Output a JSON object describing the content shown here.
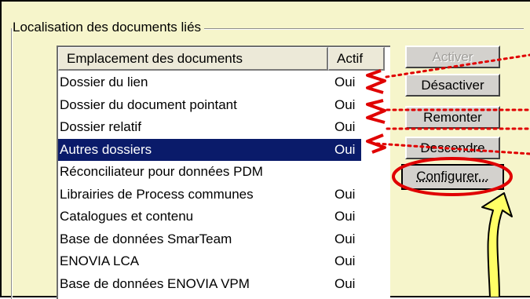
{
  "group": {
    "title": "Localisation des documents liés"
  },
  "list": {
    "columns": [
      "Emplacement des documents",
      "Actif"
    ],
    "rows": [
      {
        "location": "Dossier du lien",
        "active": "Oui",
        "selected": false
      },
      {
        "location": "Dossier du document pointant",
        "active": "Oui",
        "selected": false
      },
      {
        "location": "Dossier relatif",
        "active": "Oui",
        "selected": false
      },
      {
        "location": "Autres dossiers",
        "active": "Oui",
        "selected": true
      },
      {
        "location": "Réconciliateur pour données PDM",
        "active": "",
        "selected": false
      },
      {
        "location": "Librairies de Process communes",
        "active": "Oui",
        "selected": false
      },
      {
        "location": "Catalogues et contenu",
        "active": "Oui",
        "selected": false
      },
      {
        "location": "Base de données SmarTeam",
        "active": "Oui",
        "selected": false
      },
      {
        "location": "ENOVIA LCA",
        "active": "Oui",
        "selected": false
      },
      {
        "location": "Base de données ENOVIA VPM",
        "active": "Oui",
        "selected": false
      }
    ]
  },
  "buttons": {
    "activer": "Activer",
    "desactiver": "Désactiver",
    "remonter": "Remonter",
    "descendre": "Descendre",
    "configurer": "Configurer..."
  },
  "colors": {
    "background": "#f6f5cb",
    "selection": "#0a1b6a",
    "annotation_red": "#e00000",
    "annotation_arrow_fill": "#ffff66"
  }
}
